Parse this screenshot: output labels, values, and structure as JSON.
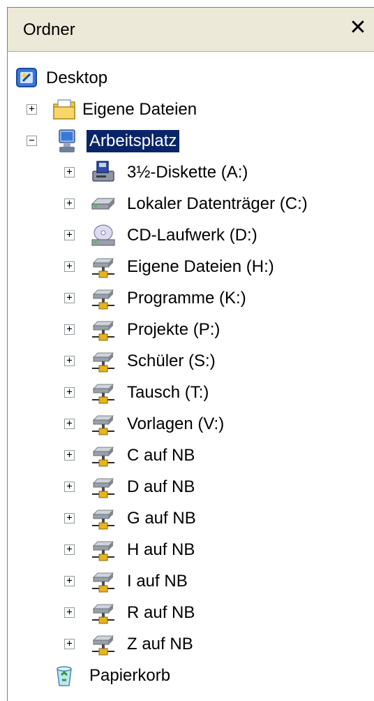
{
  "pane": {
    "title": "Ordner",
    "close_glyph": "✕"
  },
  "tree": {
    "desktop": {
      "label": "Desktop",
      "icon": "desktop-icon"
    },
    "my_documents": {
      "label": "Eigene Dateien",
      "icon": "folder-documents-icon",
      "expander": "+"
    },
    "my_computer": {
      "label": "Arbeitsplatz",
      "icon": "computer-icon",
      "expander": "−",
      "selected": true
    },
    "drives": [
      {
        "label": "3½-Diskette (A:)",
        "icon": "floppy-drive-icon",
        "expander": "+"
      },
      {
        "label": "Lokaler Datenträger (C:)",
        "icon": "hard-drive-icon",
        "expander": "+"
      },
      {
        "label": "CD-Laufwerk (D:)",
        "icon": "cd-drive-icon",
        "expander": "+"
      },
      {
        "label": "Eigene Dateien (H:)",
        "icon": "network-drive-icon",
        "expander": "+"
      },
      {
        "label": "Programme (K:)",
        "icon": "network-drive-icon",
        "expander": "+"
      },
      {
        "label": "Projekte (P:)",
        "icon": "network-drive-icon",
        "expander": "+"
      },
      {
        "label": "Schüler (S:)",
        "icon": "network-drive-icon",
        "expander": "+"
      },
      {
        "label": "Tausch (T:)",
        "icon": "network-drive-icon",
        "expander": "+"
      },
      {
        "label": "Vorlagen (V:)",
        "icon": "network-drive-icon",
        "expander": "+"
      },
      {
        "label": "C auf NB",
        "icon": "network-drive-icon",
        "expander": "+"
      },
      {
        "label": "D auf NB",
        "icon": "network-drive-icon",
        "expander": "+"
      },
      {
        "label": "G auf NB",
        "icon": "network-drive-icon",
        "expander": "+"
      },
      {
        "label": "H auf NB",
        "icon": "network-drive-icon",
        "expander": "+"
      },
      {
        "label": "I auf NB",
        "icon": "network-drive-icon",
        "expander": "+"
      },
      {
        "label": "R auf NB",
        "icon": "network-drive-icon",
        "expander": "+"
      },
      {
        "label": "Z auf NB",
        "icon": "network-drive-icon",
        "expander": "+"
      }
    ],
    "recycle_bin": {
      "label": "Papierkorb",
      "icon": "recycle-bin-icon"
    }
  },
  "colors": {
    "selection": "#0a246a",
    "header_bg": "#ece9d8"
  }
}
